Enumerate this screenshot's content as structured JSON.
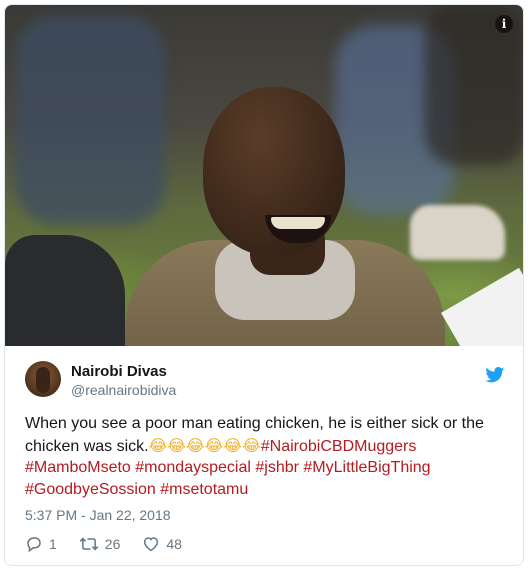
{
  "photo": {
    "icon": "info-icon",
    "info_glyph": "i"
  },
  "tweet": {
    "author_name": "Nairobi Divas",
    "author_handle": "@realnairobidiva",
    "text_plain": "When you see a poor man eating chicken, he is either sick or the chicken was sick.",
    "emojis": "😂😂😂😂😂😂",
    "hashtags": [
      "#NairobiCBDMuggers",
      "#MamboMseto",
      "#mondayspecial",
      "#jshbr",
      "#MyLittleBigThing",
      "#GoodbyeSossion",
      "#msetotamu"
    ],
    "timestamp": "5:37 PM - Jan 22, 2018",
    "replies": "1",
    "retweets": "26",
    "likes": "48"
  },
  "colors": {
    "hashtag": "#b31c20",
    "muted": "#657786",
    "twitter_blue": "#1da1f2",
    "text": "#14171a"
  },
  "icons": {
    "brand": "twitter-bird-icon",
    "reply": "reply-icon",
    "retweet": "retweet-icon",
    "like": "heart-icon"
  }
}
